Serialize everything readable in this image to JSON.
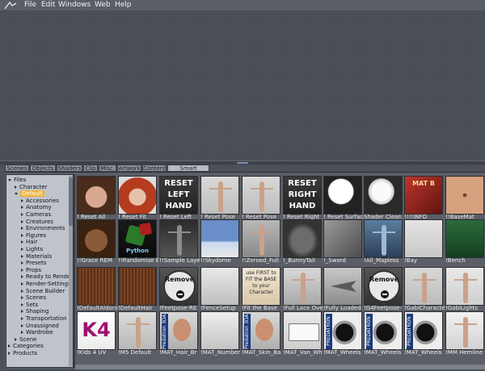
{
  "menu": {
    "items": [
      "File",
      "Edit",
      "Windows",
      "Web",
      "Help"
    ]
  },
  "tabs": [
    {
      "label": "Scenes",
      "active": false
    },
    {
      "label": "Objects",
      "active": false
    },
    {
      "label": "Shaders",
      "active": false
    },
    {
      "label": "Clip",
      "active": false
    },
    {
      "label": "Misc.",
      "active": false
    },
    {
      "label": "Artwork",
      "active": false
    },
    {
      "label": "Content",
      "active": false
    },
    {
      "label": "Smart Content",
      "active": true
    }
  ],
  "tree": [
    {
      "label": "Files",
      "level": 0,
      "expanded": true
    },
    {
      "label": "Character",
      "level": 1,
      "expanded": false
    },
    {
      "label": "Default",
      "level": 1,
      "expanded": true,
      "selected": true
    },
    {
      "label": "Accessories",
      "level": 2,
      "expanded": false
    },
    {
      "label": "Anatomy",
      "level": 2,
      "expanded": false
    },
    {
      "label": "Cameras",
      "level": 2,
      "expanded": false
    },
    {
      "label": "Creatures",
      "level": 2,
      "expanded": false
    },
    {
      "label": "Environments",
      "level": 2,
      "expanded": false
    },
    {
      "label": "Figures",
      "level": 2,
      "expanded": false
    },
    {
      "label": "Hair",
      "level": 2,
      "expanded": false
    },
    {
      "label": "Lights",
      "level": 2,
      "expanded": false
    },
    {
      "label": "Materials",
      "level": 2,
      "expanded": false
    },
    {
      "label": "Presets",
      "level": 2,
      "expanded": false
    },
    {
      "label": "Props",
      "level": 2,
      "expanded": false
    },
    {
      "label": "Ready to Render",
      "level": 2,
      "expanded": false
    },
    {
      "label": "Render-Settings",
      "level": 2,
      "expanded": false
    },
    {
      "label": "Scene Builder",
      "level": 2,
      "expanded": false
    },
    {
      "label": "Scenes",
      "level": 2,
      "expanded": false
    },
    {
      "label": "Sets",
      "level": 2,
      "expanded": false
    },
    {
      "label": "Shaping",
      "level": 2,
      "expanded": false
    },
    {
      "label": "Transportation",
      "level": 2,
      "expanded": false
    },
    {
      "label": "Unassigned",
      "level": 2,
      "expanded": false
    },
    {
      "label": "Wardrobe",
      "level": 2,
      "expanded": false
    },
    {
      "label": "Scene",
      "level": 1,
      "expanded": false
    },
    {
      "label": "Categories",
      "level": 0,
      "expanded": false
    },
    {
      "label": "Products",
      "level": 0,
      "expanded": false
    }
  ],
  "tiles": [
    {
      "caption": "! Reset All",
      "thumb": "face-female",
      "text": ""
    },
    {
      "caption": "! Reset Fit",
      "thumb": "face-redhair",
      "text": ""
    },
    {
      "caption": "! Reset Left",
      "thumb": "text-dark",
      "text": "RESET LEFT HAND"
    },
    {
      "caption": "! Reset Pose",
      "thumb": "figure-pose",
      "text": ""
    },
    {
      "caption": "! Reset Pose",
      "thumb": "figure-pose",
      "text": ""
    },
    {
      "caption": "! Reset Right",
      "thumb": "text-dark",
      "text": "RESET RIGHT HAND"
    },
    {
      "caption": "! Reset Surface",
      "thumb": "white-sphere",
      "text": ""
    },
    {
      "caption": "Shader Clean",
      "thumb": "white-sphere-flat",
      "text": ""
    },
    {
      "caption": "!!!!INFO",
      "thumb": "mat-b",
      "text": "MAT B"
    },
    {
      "caption": "!!BaseMat",
      "thumb": "skin",
      "text": ""
    },
    {
      "caption": "!!Grace REM",
      "thumb": "face-dark",
      "text": ""
    },
    {
      "caption": "!!Randomise Bl",
      "thumb": "dice",
      "text": "Python"
    },
    {
      "caption": "!!Sample Layer",
      "thumb": "figure-dark",
      "text": ""
    },
    {
      "caption": "!!Skydome",
      "thumb": "sky",
      "text": ""
    },
    {
      "caption": "!!Zeroed_Full",
      "thumb": "figure-grey",
      "text": ""
    },
    {
      "caption": "!_BunnyTail",
      "thumb": "fur",
      "text": ""
    },
    {
      "caption": "!_Sword",
      "thumb": "sword",
      "text": ""
    },
    {
      "caption": "!All_Mapless",
      "thumb": "figure-blue",
      "text": ""
    },
    {
      "caption": "!Bay",
      "thumb": "horse",
      "text": ""
    },
    {
      "caption": "!Bench",
      "thumb": "bench",
      "text": ""
    },
    {
      "caption": "!DefaultAldora",
      "thumb": "hair-brown",
      "text": ""
    },
    {
      "caption": "!DefaultHair",
      "thumb": "hair-brown",
      "text": ""
    },
    {
      "caption": "!Feetpose-RE",
      "thumb": "remove",
      "text": "Remove"
    },
    {
      "caption": "!FenceSetup",
      "thumb": "fence",
      "text": ""
    },
    {
      "caption": "!Fit the Base",
      "thumb": "fit-base",
      "text": "use FIRST to FIT the BASE to your Character"
    },
    {
      "caption": "!Full Lace Over",
      "thumb": "lace",
      "text": ""
    },
    {
      "caption": "!Fully Loaded",
      "thumb": "jet",
      "text": ""
    },
    {
      "caption": "!G4Feetpose-",
      "thumb": "remove",
      "text": "Remove"
    },
    {
      "caption": "!GabiCharacter",
      "thumb": "gabi",
      "text": ""
    },
    {
      "caption": "!GabiLights",
      "thumb": "gabi2",
      "text": ""
    },
    {
      "caption": "!Kids 4 UV",
      "thumb": "k4",
      "text": "K4"
    },
    {
      "caption": "!M5 Default",
      "thumb": "m5",
      "text": ""
    },
    {
      "caption": "!MAT_Hair_Br",
      "thumb": "pred-head",
      "text": "Predatron 3DA"
    },
    {
      "caption": "!MAT_Number",
      "thumb": "numbers",
      "text": ""
    },
    {
      "caption": "!MAT_Skin_Ba",
      "thumb": "pred-head",
      "text": "Predatron 3DA"
    },
    {
      "caption": "!MAT_Van_Wh",
      "thumb": "van",
      "text": ""
    },
    {
      "caption": "!MAT_Wheels",
      "thumb": "wheel",
      "text": "PREDATRON"
    },
    {
      "caption": "!MAT_Wheels",
      "thumb": "wheel",
      "text": "PREDATRON"
    },
    {
      "caption": "!MAT_Wheels",
      "thumb": "wheel",
      "text": "PREDATRON"
    },
    {
      "caption": "!MM Hemline 0",
      "thumb": "dress",
      "text": ""
    }
  ]
}
